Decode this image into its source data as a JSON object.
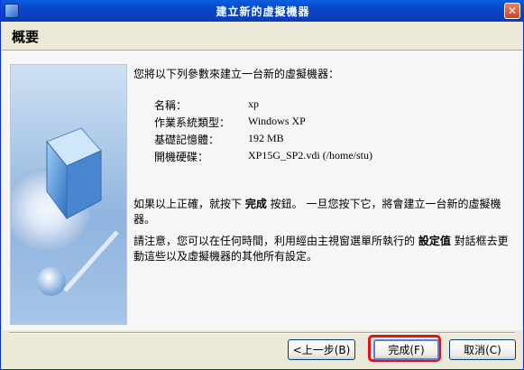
{
  "window": {
    "title": "建立新的虛擬機器"
  },
  "header": {
    "title": "概要"
  },
  "intro": "您將以下列參數來建立一台新的虛擬機器：",
  "summary": [
    {
      "label": "名稱：",
      "value": "xp"
    },
    {
      "label": "作業系統類型：",
      "value": "Windows XP"
    },
    {
      "label": "基礎記憶體：",
      "value": "192 MB"
    },
    {
      "label": "開機硬碟：",
      "value": "XP15G_SP2.vdi (/home/stu)"
    }
  ],
  "para1": {
    "part1": "如果以上正確，就按下 ",
    "bold": "完成",
    "part2": " 按鈕。 一旦您按下它，將會建立一台新的虛擬機器。"
  },
  "para2": {
    "part1": "請注意，您可以在任何時間，利用經由主視窗選單所執行的 ",
    "bold": "設定值",
    "part2": " 對話框去更動這些以及虛擬機器的其他所有設定。"
  },
  "buttons": {
    "back": "<上一步(B)",
    "finish": "完成(F)",
    "cancel": "取消(C)"
  },
  "icons": {
    "close": "close-icon",
    "app": "virtualbox-icon"
  },
  "colors": {
    "titlebar": "#0846c8",
    "highlight": "#e0121a"
  }
}
